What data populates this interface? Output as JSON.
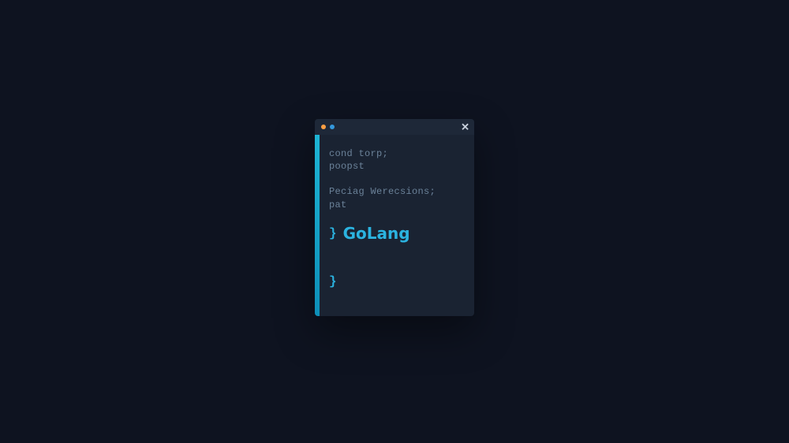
{
  "window": {
    "traffic_lights": {
      "orange": "#ff9f43",
      "blue": "#3498db"
    },
    "close_glyph": "✕"
  },
  "code": {
    "line1": "cond torp;",
    "line2": "poopst",
    "line3": "Peciag Werecsions;",
    "line4": "pat",
    "brace_open": "}",
    "highlight_label": "GoLang",
    "brace_end": "}"
  },
  "colors": {
    "bg": "#0e1320",
    "window_bg": "#1a2332",
    "titlebar_bg": "#1e2838",
    "accent": "#2bb3e0",
    "muted_text": "#6b8299"
  }
}
